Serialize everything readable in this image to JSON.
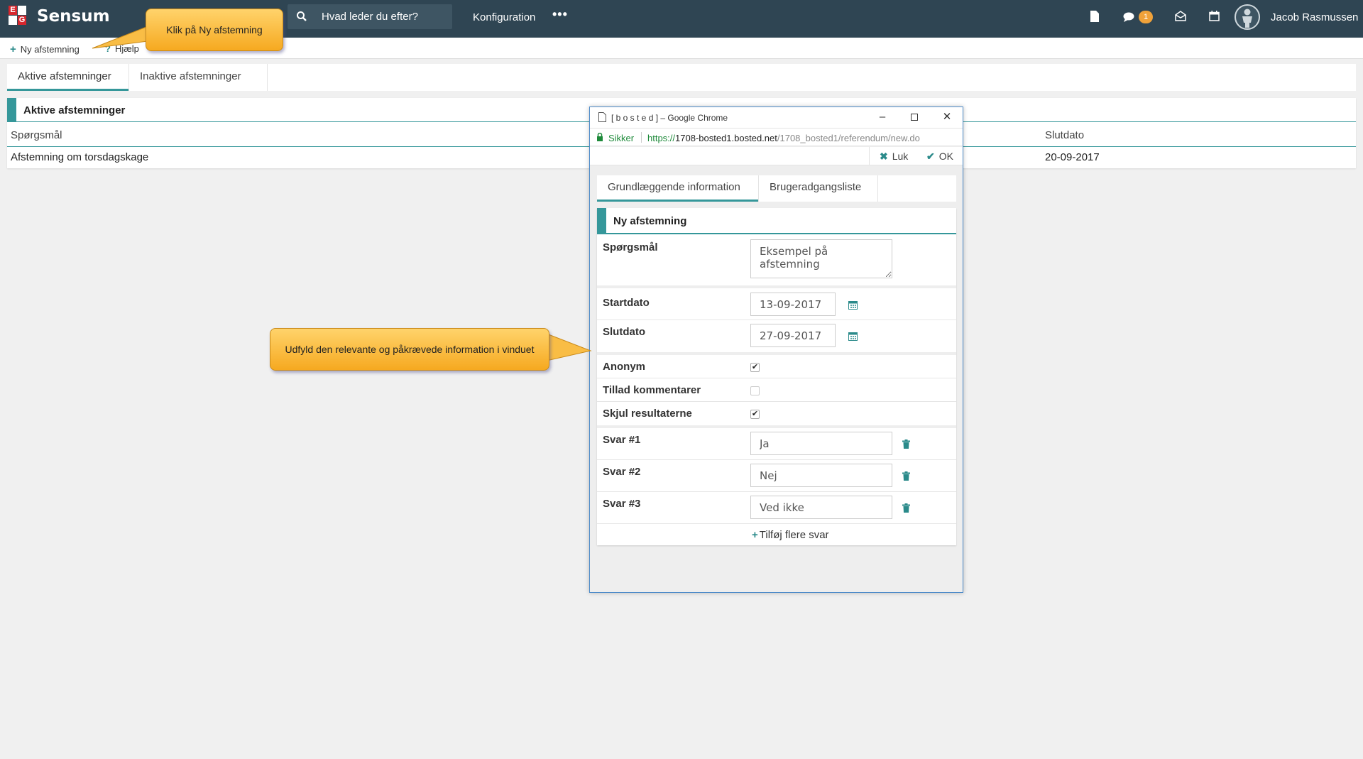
{
  "app": {
    "brand": "Sensum",
    "logo_letters": [
      "E",
      "G"
    ],
    "search_placeholder": "Hvad leder du efter?",
    "nav_config": "Konfiguration",
    "nav_more": "•••",
    "notification_count": "1",
    "user_name": "Jacob Rasmussen",
    "colors": {
      "topbar": "#2f4553",
      "accent": "#35979a",
      "badge": "#f0a23a",
      "logo_red": "#d7262d"
    }
  },
  "actions": {
    "new_label": "Ny afstemning",
    "help_label": "Hjælp"
  },
  "tabs": [
    {
      "label": "Aktive afstemninger",
      "active": true
    },
    {
      "label": "Inaktive afstemninger",
      "active": false
    }
  ],
  "panel": {
    "title": "Aktive afstemninger",
    "columns": {
      "question": "Spørgsmål",
      "end_date": "Slutdato"
    },
    "rows": [
      {
        "question": "Afstemning om torsdagskage",
        "end_date": "20-09-2017"
      }
    ]
  },
  "popup": {
    "window_title": "[ b o s t e d ] – Google Chrome",
    "secure_label": "Sikker",
    "url_scheme": "https://",
    "url_host": "1708-bosted1.bosted.net",
    "url_path": "/1708_bosted1/referendum/new.do",
    "close_label": "Luk",
    "ok_label": "OK",
    "tabs": [
      {
        "label": "Grundlæggende information",
        "active": true
      },
      {
        "label": "Brugeradgangsliste",
        "active": false
      }
    ],
    "form": {
      "title": "Ny afstemning",
      "question_label": "Spørgsmål",
      "question_value": "Eksempel på afstemning",
      "start_label": "Startdato",
      "start_value": "13-09-2017",
      "end_label": "Slutdato",
      "end_value": "27-09-2017",
      "anonymous_label": "Anonym",
      "anonymous_checked": true,
      "comments_label": "Tillad kommentarer",
      "comments_checked": false,
      "hide_results_label": "Skjul resultaterne",
      "hide_results_checked": true,
      "answers": [
        {
          "label": "Svar #1",
          "value": "Ja"
        },
        {
          "label": "Svar #2",
          "value": "Nej"
        },
        {
          "label": "Svar #3",
          "value": "Ved ikke"
        }
      ],
      "add_more_label": "Tilføj flere svar"
    }
  },
  "callouts": {
    "new_vote": "Klik på Ny afstemning",
    "fill_info": "Udfyld den relevante og påkrævede information i vinduet"
  }
}
